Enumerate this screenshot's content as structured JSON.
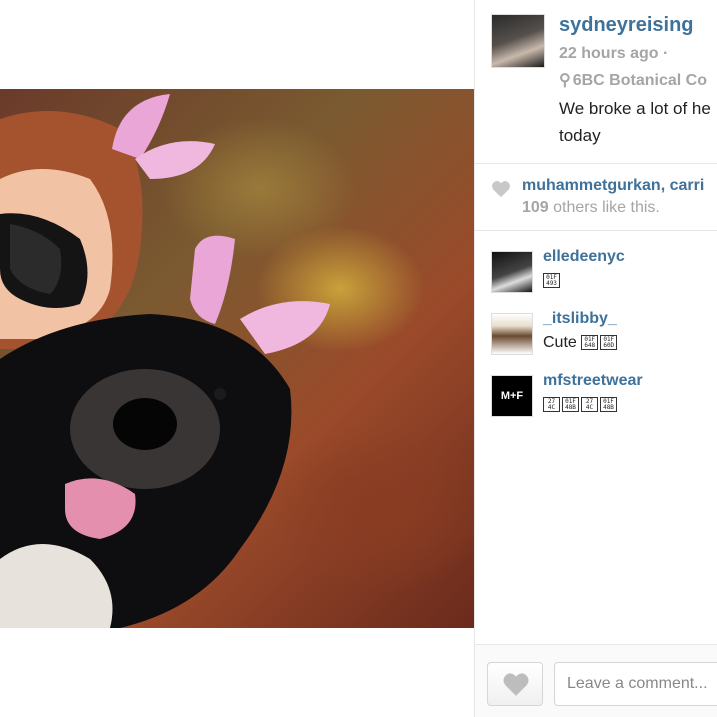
{
  "post": {
    "author": "sydneyreising",
    "time": "22 hours ago ·",
    "location": "6BC Botanical Co",
    "caption": "We broke a lot of he\ntoday"
  },
  "likes": {
    "names": "muhammetgurkan, carri",
    "count": "109",
    "count_suffix": " others like this."
  },
  "comments": [
    {
      "user": "elledeenyc",
      "text": "",
      "emoji": [
        "01F\n493"
      ]
    },
    {
      "user": "_itslibby_",
      "text": "Cute",
      "emoji": [
        "01F\n648",
        "01F\n60D"
      ]
    },
    {
      "user": "mfstreetwear",
      "text": "",
      "emoji": [
        "27\n4C",
        "01F\n48B",
        "27\n4C",
        "01F\n48B"
      ]
    }
  ],
  "comment_box": {
    "placeholder": "Leave a comment..."
  },
  "icons": {
    "location": "location-pin-icon",
    "likes": "heart-icon",
    "like_button": "heart-icon"
  },
  "colors": {
    "link": "#3f729b",
    "muted": "#a5a5a5"
  }
}
